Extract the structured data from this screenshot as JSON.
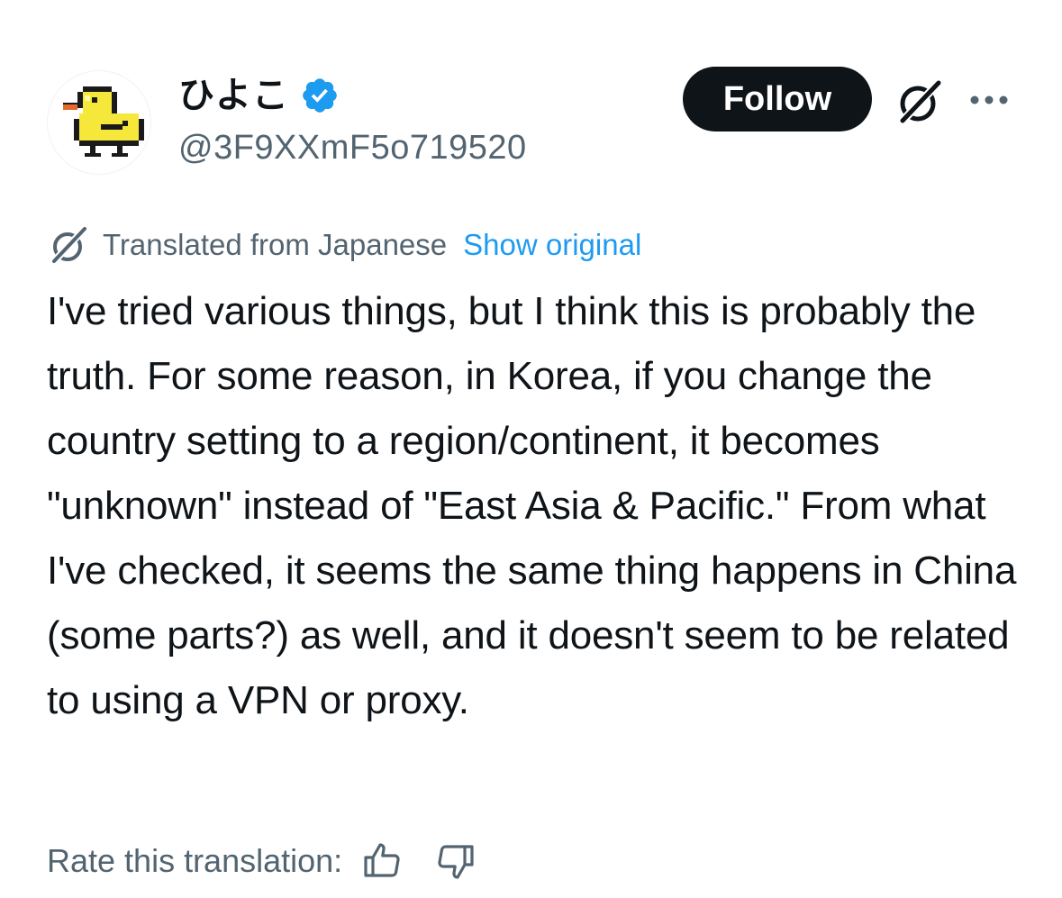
{
  "post": {
    "author": {
      "display_name": "ひよこ",
      "handle": "@3F9XXmF5o719520",
      "verified": true,
      "verified_color": "#1d9bf0",
      "avatar_icon": "pixel-chick-icon"
    },
    "follow_label": "Follow",
    "grok_icon": "grok-icon",
    "more_icon": "more-icon",
    "translation": {
      "label": "Translated from Japanese",
      "show_original": "Show original"
    },
    "text": "I've tried various things, but I think this is probably the truth. For some reason, in Korea, if you change the country setting to a region/continent, it becomes \"unknown\" instead of \"East Asia & Pacific.\" From what I've checked, it seems the same thing happens in China (some parts?) as well, and it doesn't seem to be related to using a VPN or proxy.",
    "rate": {
      "label": "Rate this translation:",
      "thumbs_up_icon": "thumbs-up-icon",
      "thumbs_down_icon": "thumbs-down-icon"
    }
  },
  "colors": {
    "text_primary": "#0f1419",
    "text_secondary": "#536471",
    "link": "#1d9bf0",
    "button_bg": "#0f1419"
  }
}
